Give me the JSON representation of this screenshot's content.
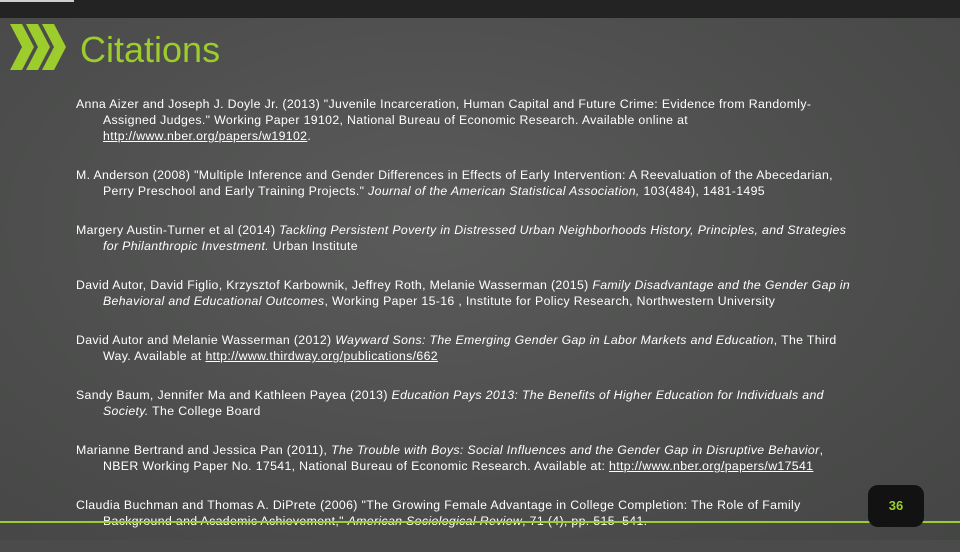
{
  "slide": {
    "title": "Citations",
    "page_number": "36",
    "accent_color": "#9ccd2c",
    "icon": "chevron-arrows-icon"
  },
  "references": [
    {
      "lines": [
        [
          {
            "t": "Anna Aizer and Joseph J. Doyle Jr. (2013) \"Juvenile Incarceration, Human Capital and Future Crime: Evidence from Randomly-"
          }
        ],
        [
          {
            "t": "Assigned Judges.\" Working Paper 19102, National Bureau of Economic Research. Available online at"
          }
        ],
        [
          {
            "t": "http://www.nber.org/papers/w19102",
            "s": "link"
          },
          {
            "t": "."
          }
        ]
      ]
    },
    {
      "lines": [
        [
          {
            "t": "M. Anderson (2008) \"Multiple Inference and Gender Differences in Effects of Early Intervention: A Reevaluation of the Abecedarian,"
          }
        ],
        [
          {
            "t": "Perry Preschool and Early Training Projects.\" "
          },
          {
            "t": "Journal of the American Statistical Association,",
            "s": "i"
          },
          {
            "t": " 103(484), 1481-1495"
          }
        ]
      ]
    },
    {
      "lines": [
        [
          {
            "t": "Margery Austin-Turner et al (2014) "
          },
          {
            "t": "Tackling Persistent Poverty in Distressed Urban Neighborhoods History, Principles, and Strategies",
            "s": "i"
          }
        ],
        [
          {
            "t": "for Philanthropic Investment.",
            "s": "i"
          },
          {
            "t": " Urban Institute"
          }
        ]
      ]
    },
    {
      "lines": [
        [
          {
            "t": "David Autor, David Figlio, Krzysztof Karbownik, Jeffrey Roth, Melanie Wasserman (2015) "
          },
          {
            "t": "Family Disadvantage and the Gender Gap in",
            "s": "i"
          }
        ],
        [
          {
            "t": "Behavioral and Educational Outcomes",
            "s": "i"
          },
          {
            "t": ", Working Paper 15-16 , Institute for Policy Research, Northwestern University"
          }
        ]
      ]
    },
    {
      "lines": [
        [
          {
            "t": "David Autor and Melanie Wasserman (2012) "
          },
          {
            "t": "Wayward Sons: The Emerging Gender Gap in Labor Markets and Education",
            "s": "i"
          },
          {
            "t": ", The Third"
          }
        ],
        [
          {
            "t": "Way. Available at "
          },
          {
            "t": "http://www.thirdway.org/publications/662",
            "s": "link"
          }
        ]
      ]
    },
    {
      "lines": [
        [
          {
            "t": "Sandy Baum, Jennifer Ma and Kathleen Payea (2013) "
          },
          {
            "t": "Education Pays 2013: The Benefits of Higher Education for Individuals and",
            "s": "i"
          }
        ],
        [
          {
            "t": "Society.",
            "s": "i"
          },
          {
            "t": " The College Board"
          }
        ]
      ]
    },
    {
      "lines": [
        [
          {
            "t": "Marianne Bertrand and Jessica Pan (2011), "
          },
          {
            "t": "The Trouble with Boys: Social Influences and the Gender Gap in Disruptive Behavior",
            "s": "i"
          },
          {
            "t": ","
          }
        ],
        [
          {
            "t": "NBER Working Paper No. 17541, National Bureau of Economic Research. Available at: "
          },
          {
            "t": "http://www.nber.org/papers/w17541",
            "s": "link"
          }
        ]
      ]
    },
    {
      "lines": [
        [
          {
            "t": "Claudia Buchman and Thomas A. DiPrete (2006) \"The Growing Female Advantage in College Completion: The Role of Family"
          }
        ],
        [
          {
            "t": "Background and Academic Achievement,\" "
          },
          {
            "t": "American Sociological Review",
            "s": "i"
          },
          {
            "t": ", 71 (4), pp. 515–541."
          }
        ]
      ]
    }
  ]
}
